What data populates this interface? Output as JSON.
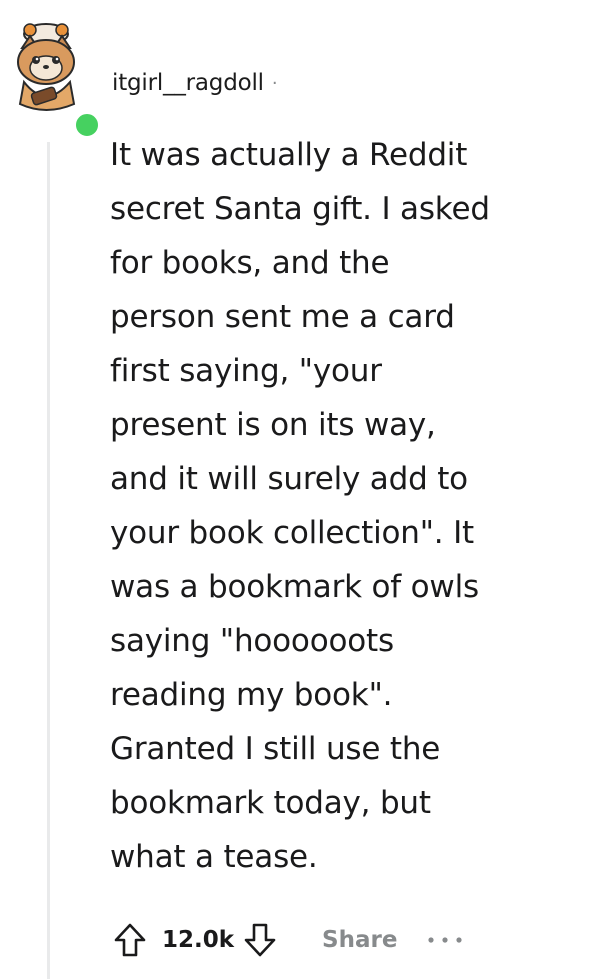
{
  "comment": {
    "username": "itgirl__ragdoll",
    "separator": "·",
    "body_lines": [
      "It was actually a Reddit",
      "secret Santa gift. I asked",
      "for books, and the",
      "person sent me a card",
      "first saying, \"your",
      "present is on its way,",
      "and it will surely add to",
      "your book collection\". It",
      "was a bookmark of owls",
      "saying \"hoooooots",
      "reading my book\".",
      "Granted I still use the",
      "bookmark today, but",
      "what a tease."
    ]
  },
  "actions": {
    "upvote_icon": "arrow-up-icon",
    "score": "12.0k",
    "downvote_icon": "arrow-down-icon",
    "share_label": "Share",
    "more_icon": "ellipsis-icon"
  },
  "colors": {
    "online": "#46d160",
    "thread_line": "#e9eaeb",
    "muted": "#878a8c",
    "text": "#1a1a1b"
  }
}
